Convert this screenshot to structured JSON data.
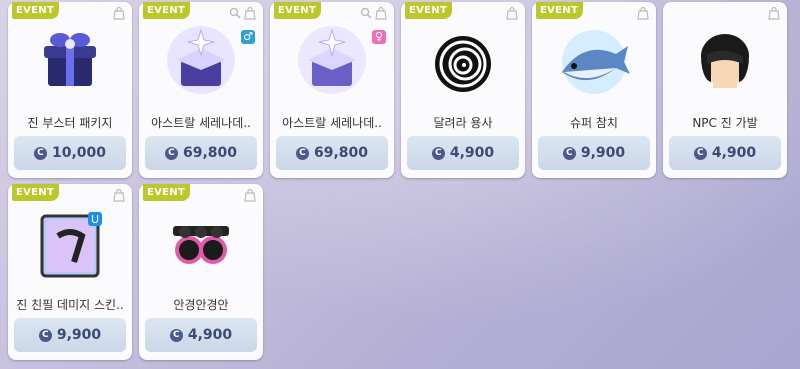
{
  "items": [
    {
      "event": "EVENT",
      "name": "진 부스터 패키지",
      "price": "10,000",
      "icon": "gift-box-icon",
      "search": false
    },
    {
      "event": "EVENT",
      "name": "아스트랄 세레나데..",
      "price": "69,800",
      "icon": "astral-box-icon",
      "search": true,
      "gender": "♂",
      "gender_color": "#2f9fd8"
    },
    {
      "event": "EVENT",
      "name": "아스트랄 세레나데..",
      "price": "69,800",
      "icon": "astral-box-icon",
      "search": true,
      "gender": "♀",
      "gender_color": "#ef6fb6"
    },
    {
      "event": "EVENT",
      "name": "달려라 용사",
      "price": "4,900",
      "icon": "spiral-icon",
      "search": false
    },
    {
      "event": "EVENT",
      "name": "슈퍼 참치",
      "price": "9,900",
      "icon": "tuna-fish-icon",
      "search": false
    },
    {
      "event": "",
      "name": "NPC 진 가발",
      "price": "4,900",
      "icon": "hair-wig-icon",
      "search": false
    },
    {
      "event": "EVENT",
      "name": "진 친필 데미지 스킨..",
      "price": "9,900",
      "icon": "damage-skin-icon",
      "search": false
    },
    {
      "event": "EVENT",
      "name": "안경안경안",
      "price": "4,900",
      "icon": "sunglasses-icon",
      "search": false
    }
  ],
  "currency_symbol": "C",
  "colors": {
    "event_tag": "#bcc72a",
    "price_text": "#3c4a73"
  }
}
